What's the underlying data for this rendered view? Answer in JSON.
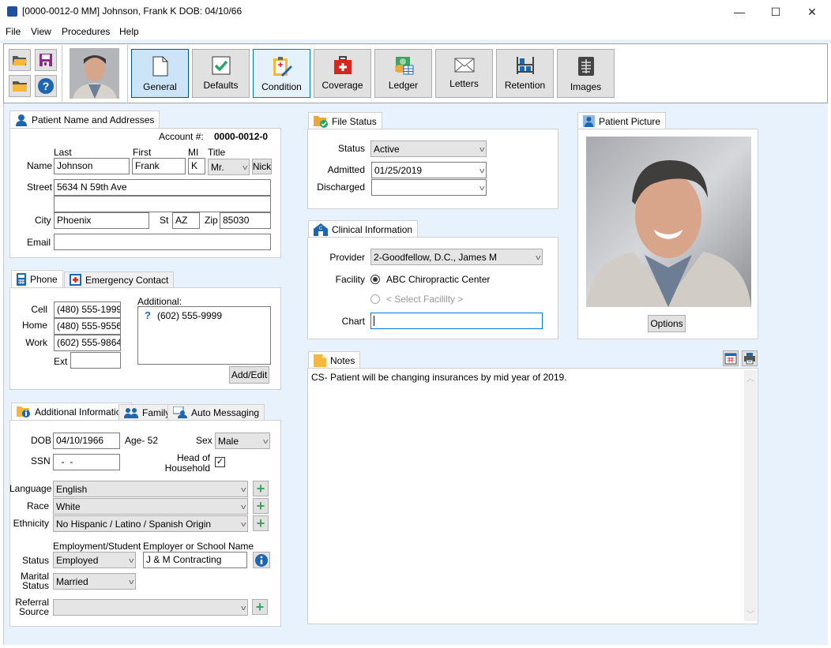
{
  "window": {
    "title": "[0000-0012-0 MM]  Johnson, Frank K  DOB: 04/10/66",
    "minimize": "—",
    "maximize": "☐",
    "close": "✕"
  },
  "menu": [
    "File",
    "View",
    "Procedures",
    "Help"
  ],
  "toolbar": {
    "buttons": [
      {
        "label": "General",
        "icon": "document-icon"
      },
      {
        "label": "Defaults",
        "icon": "checkmark-icon"
      },
      {
        "label": "Condition",
        "icon": "clipboard-icon"
      },
      {
        "label": "Coverage",
        "icon": "first-aid-icon"
      },
      {
        "label": "Ledger",
        "icon": "ledger-icon"
      },
      {
        "label": "Letters",
        "icon": "envelope-icon"
      },
      {
        "label": "Retention",
        "icon": "shelf-icon"
      },
      {
        "label": "Images",
        "icon": "xray-icon"
      }
    ]
  },
  "patient_name": {
    "tab": "Patient Name and Addresses",
    "account_label": "Account #:",
    "account": "0000-0012-0",
    "col_last": "Last",
    "col_first": "First",
    "col_mi": "MI",
    "col_title": "Title",
    "name_label": "Name",
    "last": "Johnson",
    "first": "Frank",
    "mi": "K",
    "title": "Mr.",
    "nick": "Nick",
    "street_label": "Street",
    "street1": "5634 N 59th Ave",
    "street2": "",
    "city_label": "City",
    "city": "Phoenix",
    "st_label": "St",
    "state": "AZ",
    "zip_label": "Zip",
    "zip": "85030",
    "email_label": "Email",
    "email": ""
  },
  "phone": {
    "tab_phone": "Phone",
    "tab_emergency": "Emergency Contact",
    "cell_label": "Cell",
    "cell": "(480) 555-1999",
    "home_label": "Home",
    "home": "(480) 555-9556",
    "work_label": "Work",
    "work": "(602) 555-9864",
    "ext_label": "Ext",
    "ext": "",
    "additional_label": "Additional:",
    "additional": [
      {
        "icon": "?",
        "number": "(602) 555-9999"
      }
    ],
    "add_edit": "Add/Edit"
  },
  "additional": {
    "tab_additional": "Additional Information",
    "tab_family": "Family",
    "tab_auto": "Auto Messaging",
    "dob_label": "DOB",
    "dob": "04/10/1966",
    "age": "Age- 52",
    "sex_label": "Sex",
    "sex": "Male",
    "ssn_label": "SSN",
    "ssn": "  -  -",
    "head_label_1": "Head of",
    "head_label_2": "Household",
    "head_checked": true,
    "language_label": "Language",
    "language": "English",
    "race_label": "Race",
    "race": "White",
    "ethnicity_label": "Ethnicity",
    "ethnicity": "No Hispanic / Latino / Spanish Origin",
    "employment_header": "Employment/Student",
    "employer_header": "Employer or School Name",
    "status_label": "Status",
    "employment": "Employed",
    "employer": "J & M Contracting",
    "marital_label_1": "Marital",
    "marital_label_2": "Status",
    "marital": "Married",
    "referral_label_1": "Referral",
    "referral_label_2": "Source",
    "referral": ""
  },
  "file_status": {
    "tab": "File Status",
    "status_label": "Status",
    "status": "Active",
    "admitted_label": "Admitted",
    "admitted": "01/25/2019",
    "discharged_label": "Discharged",
    "discharged": ""
  },
  "clinical": {
    "tab": "Clinical Information",
    "provider_label": "Provider",
    "provider": "2-Goodfellow, D.C., James M",
    "facility_label": "Facility",
    "facility_option_1": "ABC Chiropractic Center",
    "facility_option_2": "< Select Facililty >",
    "chart_label": "Chart",
    "chart": ""
  },
  "picture": {
    "tab": "Patient Picture",
    "options": "Options"
  },
  "notes": {
    "tab": "Notes",
    "text": "CS- Patient will be changing insurances by mid year of 2019."
  }
}
